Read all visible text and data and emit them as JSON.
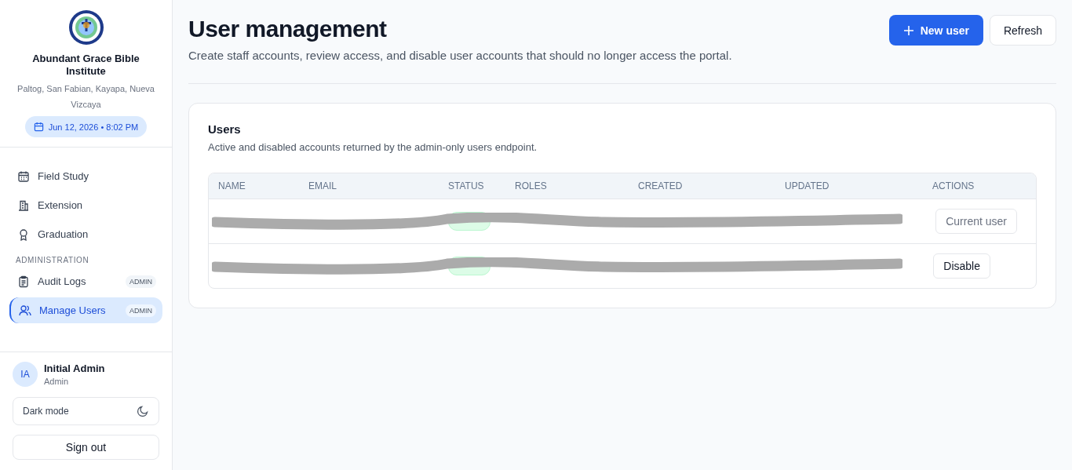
{
  "sidebar": {
    "org_name": "Abundant Grace Bible Institute",
    "org_address": "Paltog, San Fabian, Kayapa, Nueva Vizcaya",
    "datetime": "Jun 12, 2026 • 8:02 PM",
    "nav": [
      {
        "kind": "item",
        "label": "Field Study",
        "selected": false
      },
      {
        "kind": "item",
        "label": "Extension",
        "selected": false
      },
      {
        "kind": "item",
        "label": "Graduation",
        "selected": false
      },
      {
        "kind": "section",
        "label": "ADMINISTRATION"
      },
      {
        "kind": "item",
        "label": "Audit Logs",
        "badge": "ADMIN",
        "selected": false
      },
      {
        "kind": "item",
        "label": "Manage Users",
        "badge": "ADMIN",
        "selected": true
      }
    ],
    "user": {
      "initials": "IA",
      "name": "Initial Admin",
      "role": "Admin"
    },
    "dark_mode": {
      "label": "Dark mode"
    },
    "sign_out": "Sign out"
  },
  "header": {
    "title": "User management",
    "subtitle": "Create staff accounts, review access, and disable user accounts that should no longer access the portal.",
    "new_user": "New user",
    "refresh": "Refresh"
  },
  "users_card": {
    "title": "Users",
    "description": "Active and disabled accounts returned by the admin-only users endpoint.",
    "table": {
      "columns": [
        "NAME",
        "EMAIL",
        "STATUS",
        "ROLES",
        "CREATED",
        "UPDATED",
        "ACTIONS"
      ],
      "rows": [
        {
          "action": {
            "label": "Current user",
            "disabled": true
          }
        },
        {
          "action": {
            "label": "Disable",
            "disabled": false
          }
        }
      ]
    }
  }
}
